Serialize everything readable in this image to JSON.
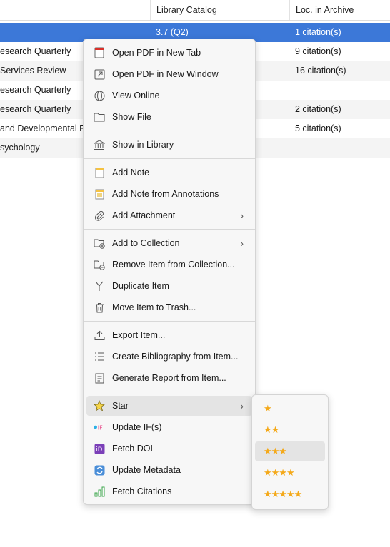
{
  "table": {
    "columns": [
      "Library Catalog",
      "Loc. in Archive"
    ],
    "rows": [
      {
        "title": "",
        "catalog": "3.7 (Q2)",
        "loc": "1 citation(s)"
      },
      {
        "title": "esearch Quarterly",
        "catalog": "",
        "loc": "9 citation(s)"
      },
      {
        "title": " Services Review",
        "catalog": "",
        "loc": "16 citation(s)"
      },
      {
        "title": "esearch Quarterly",
        "catalog": "",
        "loc": ""
      },
      {
        "title": "esearch Quarterly",
        "catalog": "",
        "loc": "2 citation(s)"
      },
      {
        "title": "and Developmental P",
        "catalog": "",
        "loc": "5 citation(s)"
      },
      {
        "title": "sychology",
        "catalog": "",
        "loc": ""
      }
    ]
  },
  "menu": {
    "items": [
      {
        "label": "Open PDF in New Tab",
        "icon": "pdf-tab-icon"
      },
      {
        "label": "Open PDF in New Window",
        "icon": "open-window-icon"
      },
      {
        "label": "View Online",
        "icon": "globe-icon"
      },
      {
        "label": "Show File",
        "icon": "folder-icon"
      },
      {
        "label": "Show in Library",
        "icon": "library-icon"
      },
      {
        "label": "Add Note",
        "icon": "note-icon"
      },
      {
        "label": "Add Note from Annotations",
        "icon": "annotation-note-icon"
      },
      {
        "label": "Add Attachment",
        "icon": "paperclip-icon"
      },
      {
        "label": "Add to Collection",
        "icon": "add-collection-icon"
      },
      {
        "label": "Remove Item from Collection...",
        "icon": "remove-collection-icon"
      },
      {
        "label": "Duplicate Item",
        "icon": "duplicate-icon"
      },
      {
        "label": "Move Item to Trash...",
        "icon": "trash-icon"
      },
      {
        "label": "Export Item...",
        "icon": "export-icon"
      },
      {
        "label": "Create Bibliography from Item...",
        "icon": "bibliography-icon"
      },
      {
        "label": "Generate Report from Item...",
        "icon": "report-icon"
      },
      {
        "label": "Star",
        "icon": "star-icon"
      },
      {
        "label": "Update IF(s)",
        "icon": "if-icon"
      },
      {
        "label": "Fetch DOI",
        "icon": "doi-icon"
      },
      {
        "label": "Update Metadata",
        "icon": "update-metadata-icon"
      },
      {
        "label": "Fetch Citations",
        "icon": "citations-chart-icon"
      }
    ]
  },
  "star_submenu": {
    "items": [
      "★",
      "★★",
      "★★★",
      "★★★★",
      "★★★★★"
    ],
    "selected_index": 2
  },
  "colors": {
    "selection": "#3c78d8",
    "star": "#f4a91a",
    "menu_bg": "#f7f7f7",
    "hover": "#e4e4e4"
  }
}
